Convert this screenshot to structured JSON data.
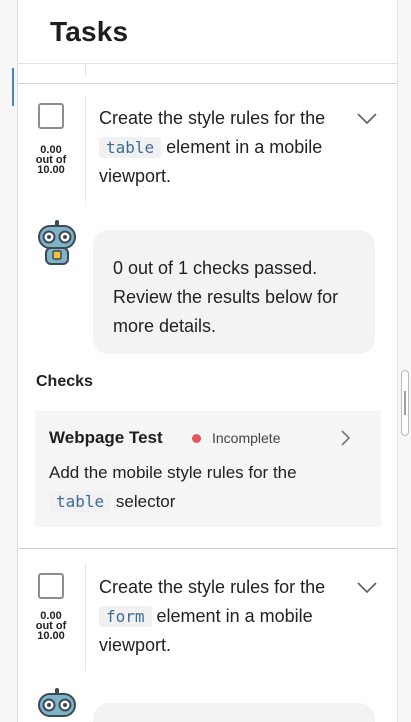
{
  "header": {
    "title": "Tasks"
  },
  "tasks": [
    {
      "score_value": "0.00",
      "score_out_of": "out of",
      "score_max": "10.00",
      "description_before": "Create the style rules for the ",
      "description_code": "table",
      "description_after": " element in a mobile viewport.",
      "feedback": "0 out of 1 checks passed. Review the results below for more details.",
      "checks_label": "Checks",
      "checks": [
        {
          "title": "Webpage Test",
          "status": "Incomplete",
          "status_color": "#e0565b",
          "description_before": "Add the mobile style rules for the ",
          "description_code": "table",
          "description_after": " selector"
        }
      ]
    },
    {
      "score_value": "0.00",
      "score_out_of": "out of",
      "score_max": "10.00",
      "description_before": "Create the style rules for the ",
      "description_code": "form",
      "description_after": " element in a mobile viewport."
    }
  ]
}
